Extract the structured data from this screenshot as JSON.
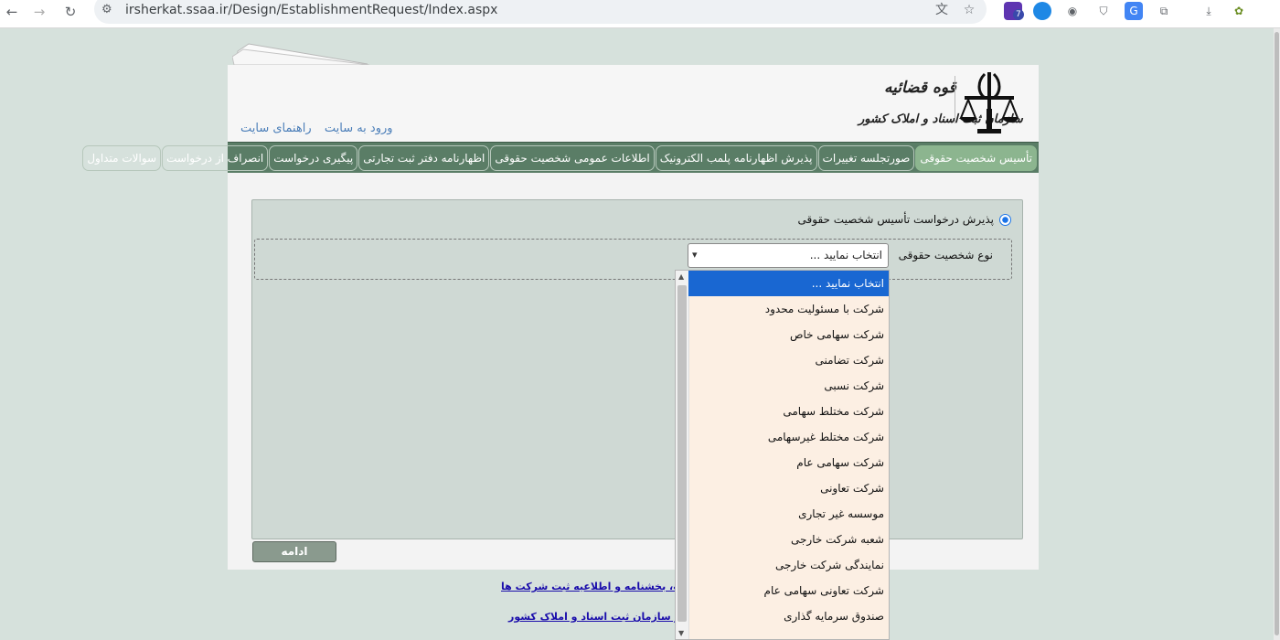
{
  "browser": {
    "url": "irsherkat.ssaa.ir/Design/EstablishmentRequest/Index.aspx",
    "extension_badge": "7"
  },
  "header": {
    "brand_line1": "قوه قضائیه",
    "brand_line2": "سازمان ثبت اسناد و املاک کشور",
    "links": [
      "ورود به سایت",
      "راهنمای سایت"
    ]
  },
  "menu": {
    "items": [
      {
        "label": "تأسیس شخصیت حقوقی",
        "active": true
      },
      {
        "label": "صورتجلسه تغییرات",
        "active": false
      },
      {
        "label": "پذیرش اظهارنامه پلمب الکترونیک",
        "active": false
      },
      {
        "label": "اطلاعات عمومی شخصیت حقوقی",
        "active": false
      },
      {
        "label": "اظهارنامه دفتر ثبت تجارتی",
        "active": false
      },
      {
        "label": "پیگیری درخواست",
        "active": false
      },
      {
        "label": "انصراف از درخواست",
        "active": false
      },
      {
        "label": "سوالات متداول",
        "active": false
      }
    ]
  },
  "form": {
    "radio_label": "پذیرش درخواست تأسیس شخصیت حقوقی",
    "field_label": "نوع شخصیت حقوقی",
    "select_value": "انتخاب نمایید ...",
    "continue_label": "ادامه"
  },
  "dropdown": {
    "options": [
      "انتخاب نمایید ...",
      "شرکت با مسئولیت محدود",
      "شرکت سهامی خاص",
      "شرکت تضامنی",
      "شرکت نسبی",
      "شرکت مختلط سهامی",
      "شرکت مختلط غیرسهامی",
      "شرکت سهامی عام",
      "شرکت تعاونی",
      "موسسه غیر تجاری",
      "شعبه شرکت خارجی",
      "نمایندگی شرکت خارجی",
      "شرکت تعاونی سهامی عام",
      "صندوق سرمایه گذاری"
    ],
    "selected_index": 0
  },
  "footer": {
    "link1": "...ن، مقررات، بخشنامه و اطلاعیه ثبت شرکت ها",
    "link2": "...ر مالیاتی و سازمان ثبت اسناد و املاک کشور"
  },
  "colors": {
    "menu_bg": "#5a7d66",
    "menu_active": "#8cb58f",
    "link": "#4c7fb9",
    "selection": "#1967d2",
    "dropdown_bg": "#fcefe3"
  }
}
